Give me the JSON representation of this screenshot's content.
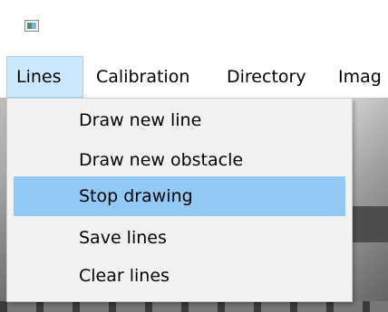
{
  "window": {
    "icon": "app-window-icon"
  },
  "menubar": {
    "items": [
      {
        "label": "Lines",
        "active": true
      },
      {
        "label": "Calibration"
      },
      {
        "label": "Directory"
      },
      {
        "label": "Imag"
      }
    ]
  },
  "dropdown": {
    "items": [
      {
        "label": "Draw new line"
      },
      {
        "label": "Draw new obstacle"
      },
      {
        "label": "Stop drawing",
        "highlighted": true
      },
      {
        "label": "Save lines"
      },
      {
        "label": "Clear lines"
      }
    ]
  },
  "colors": {
    "menu_active_bg": "#cce8ff",
    "menu_active_border": "#99d1ff",
    "item_highlight": "#91c9f7",
    "dropdown_bg": "#f2f2f2"
  }
}
